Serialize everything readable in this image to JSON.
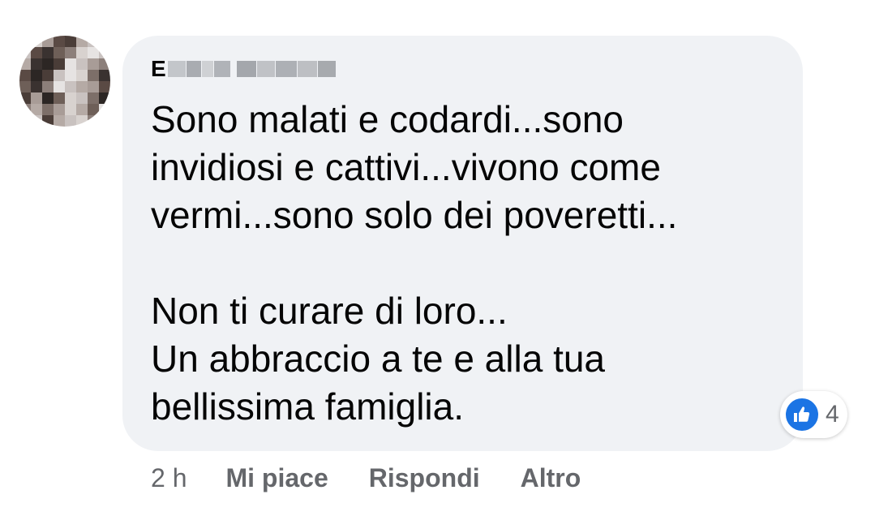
{
  "comment": {
    "author": {
      "initial": "E",
      "name_redacted": true
    },
    "text_lines": [
      "Sono malati e codardi...sono",
      "invidiosi e cattivi...vivono come",
      "vermi...sono solo dei poveretti...",
      "",
      "Non ti curare di loro...",
      "Un abbraccio a te e alla tua",
      "bellissima famiglia."
    ],
    "reactions": {
      "icon": "thumbs-up-icon",
      "count": "4",
      "color": "#1b74e4"
    },
    "meta": {
      "time": "2 h",
      "like_label": "Mi piace",
      "reply_label": "Rispondi",
      "more_label": "Altro"
    }
  },
  "colors": {
    "bubble": "#f0f2f5",
    "text": "#050505",
    "secondary_text": "#65676b"
  }
}
